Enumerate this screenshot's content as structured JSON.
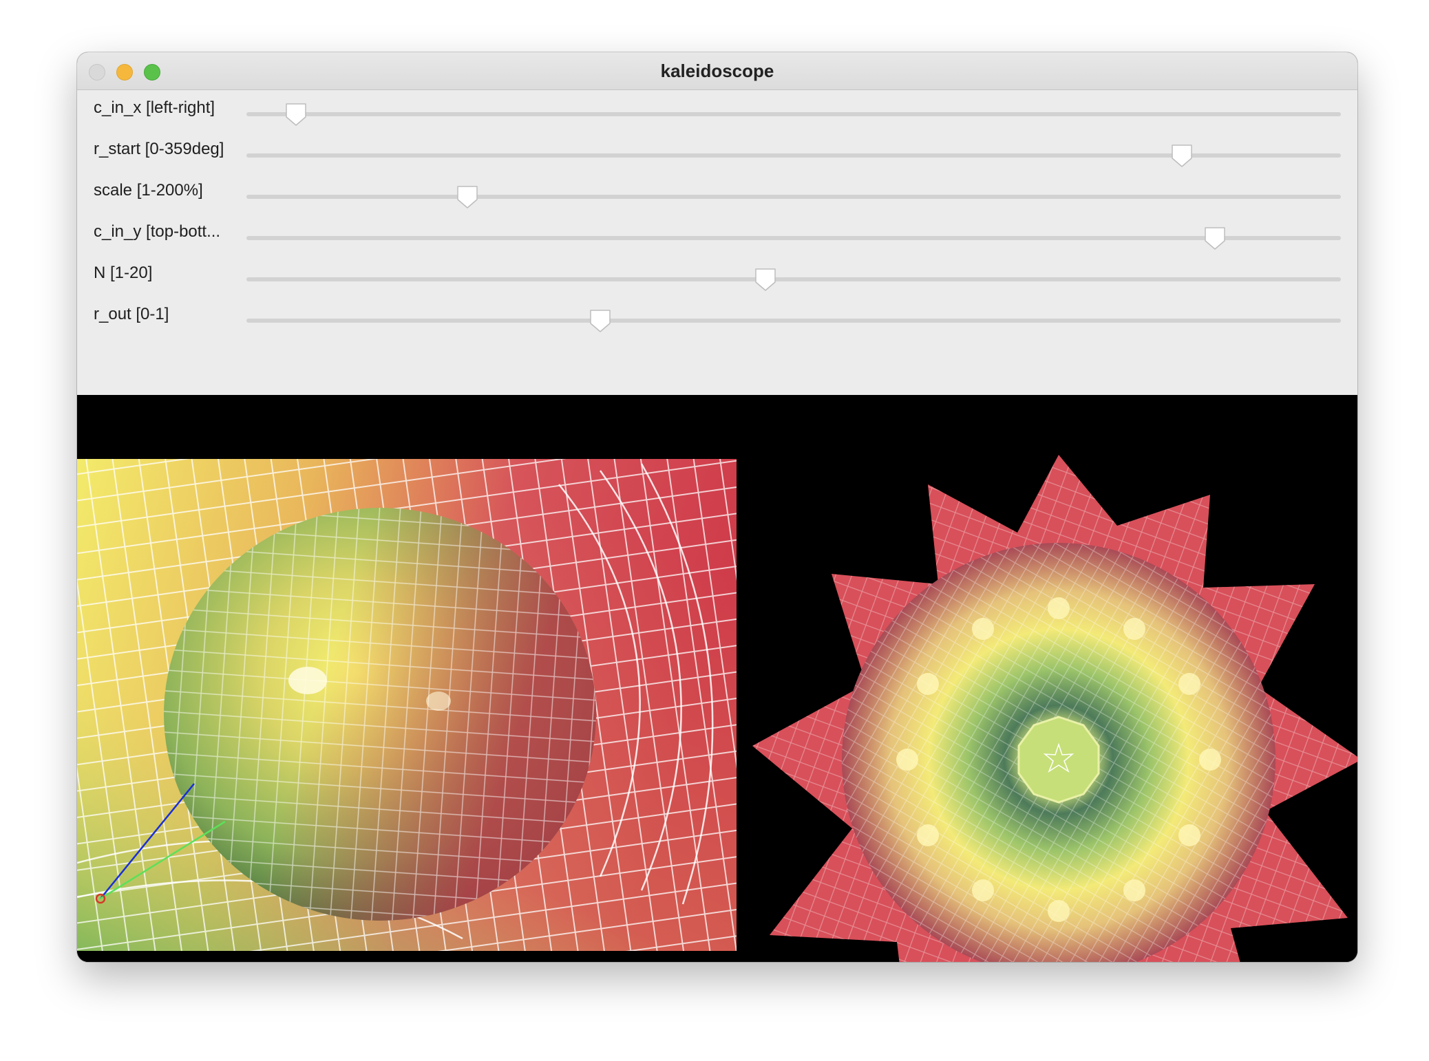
{
  "window": {
    "title": "kaleidoscope"
  },
  "sliders": [
    {
      "label": "c_in_x [left-right]",
      "value": 0.045
    },
    {
      "label": "r_start [0-359deg]",
      "value": 0.855
    },
    {
      "label": "scale [1-200%]",
      "value": 0.202
    },
    {
      "label": "c_in_y [top-bott...",
      "value": 0.885
    },
    {
      "label": "N [1-20]",
      "value": 0.474
    },
    {
      "label": "r_out [0-1]",
      "value": 0.323
    }
  ],
  "colors": {
    "titlebar": "#dcdcdc",
    "panel": "#ececec",
    "viewport": "#000000",
    "close": "#d9d9d9",
    "minimize": "#f5b83d",
    "maximize": "#5ac24b"
  },
  "views": {
    "source": "sphere-on-warped-grid",
    "output": "kaleidoscope-star"
  }
}
